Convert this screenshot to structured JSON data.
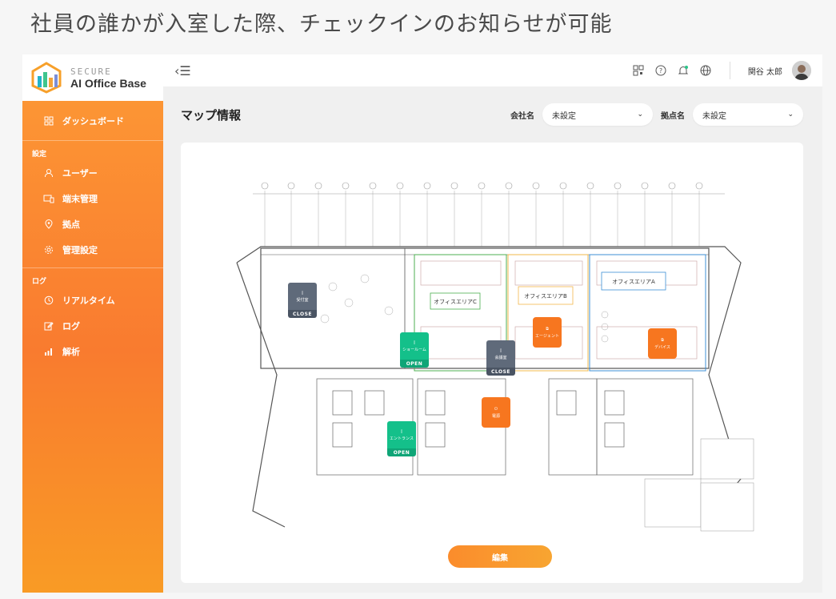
{
  "caption": "社員の誰かが入室した際、チェックインのお知らせが可能",
  "logo": {
    "top": "SECURE",
    "bottom": "AI Office Base"
  },
  "sidebar": {
    "dashboard": "ダッシュボード",
    "section_settings": "設定",
    "section_log": "ログ",
    "items": [
      {
        "label": "ユーザー",
        "icon": "user-icon"
      },
      {
        "label": "端末管理",
        "icon": "devices-icon"
      },
      {
        "label": "拠点",
        "icon": "location-pin-icon"
      },
      {
        "label": "管理設定",
        "icon": "settings-gear-icon"
      },
      {
        "label": "リアルタイム",
        "icon": "clock-icon"
      },
      {
        "label": "ログ",
        "icon": "edit-log-icon"
      },
      {
        "label": "解析",
        "icon": "bar-chart-icon"
      }
    ]
  },
  "topbar": {
    "collapse_icon": "‹☰",
    "username": "関谷 太郎"
  },
  "header": {
    "title": "マップ情報",
    "company_label": "会社名",
    "company_value": "未設定",
    "site_label": "拠点名",
    "site_value": "未設定"
  },
  "map": {
    "areas": {
      "area_c": "オフィスエリアC",
      "area_b": "オフィスエリアB",
      "area_a": "オフィスエリアA"
    },
    "markers": {
      "reception": {
        "label": "受付室",
        "status": "CLOSE"
      },
      "showroom": {
        "label": "ショールーム",
        "status": "OPEN"
      },
      "meeting": {
        "label": "会議室",
        "status": "CLOSE"
      },
      "entrance": {
        "label": "エントランス",
        "status": "OPEN"
      },
      "agent": {
        "label": "エージェント"
      },
      "device": {
        "label": "デバイス"
      },
      "power": {
        "label": "電源"
      }
    }
  },
  "edit_button": "編集",
  "colors": {
    "accent": "#f97b2f",
    "open": "#14c08a",
    "close": "#5f6a7a"
  }
}
